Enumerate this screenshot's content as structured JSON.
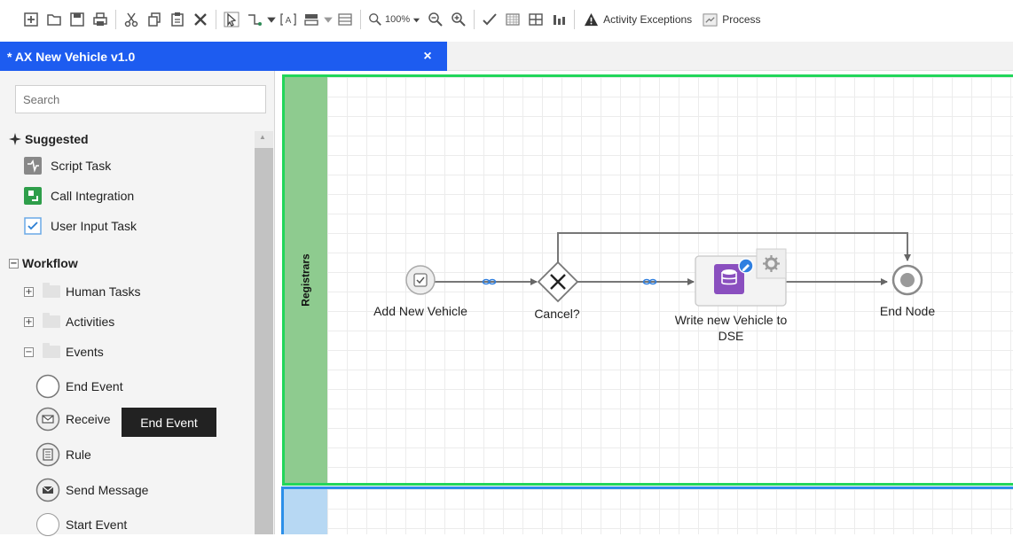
{
  "toolbar": {
    "zoom_value": "100%",
    "activity_exceptions_label": "Activity Exceptions",
    "process_label": "Process",
    "icons": [
      "add-icon",
      "open-folder-icon",
      "save-icon",
      "print-icon",
      "cut-icon",
      "copy-icon",
      "paste-icon",
      "delete-icon",
      "select-icon",
      "connector-icon",
      "text-annotation-icon",
      "lane-icon",
      "swimlane-icon",
      "zoom-icon",
      "zoom-out-icon",
      "zoom-in-icon",
      "validate-check-icon",
      "grid-icon",
      "table-icon",
      "bar-chart-icon",
      "warning-icon",
      "process-icon"
    ]
  },
  "tab": {
    "title": "* AX New Vehicle v1.0",
    "close_symbol": "×",
    "color": "#1d5cf0"
  },
  "sidebar": {
    "search_placeholder": "Search",
    "suggested_header": "Suggested",
    "suggested": [
      {
        "label": "Script Task",
        "icon": "script-task-icon"
      },
      {
        "label": "Call Integration",
        "icon": "call-integration-icon"
      },
      {
        "label": "User Input Task",
        "icon": "user-input-task-icon"
      }
    ],
    "workflow_header": "Workflow",
    "groups": [
      {
        "label": "Human Tasks",
        "expander": "+"
      },
      {
        "label": "Activities",
        "expander": "+"
      },
      {
        "label": "Events",
        "expander": "−"
      }
    ],
    "events": [
      {
        "label": "End Event",
        "icon": "end-event-icon"
      },
      {
        "label": "Receive",
        "icon": "receive-message-icon"
      },
      {
        "label": "Rule",
        "icon": "rule-icon"
      },
      {
        "label": "Send Message",
        "icon": "send-message-icon"
      },
      {
        "label": "Start Event",
        "icon": "start-event-icon"
      }
    ],
    "tooltip": "End Event"
  },
  "canvas": {
    "lane1_label": "Registrars",
    "lane1_color": "#8ecb8f",
    "lane1_border": "#22d65a",
    "lane2_color": "#b7d8f3",
    "lane2_border": "#2b8fe9",
    "nodes": {
      "start": "Add New Vehicle",
      "gateway": "Cancel?",
      "task_line1": "Write new Vehicle to",
      "task_line2": "DSE",
      "end": "End Node"
    }
  }
}
